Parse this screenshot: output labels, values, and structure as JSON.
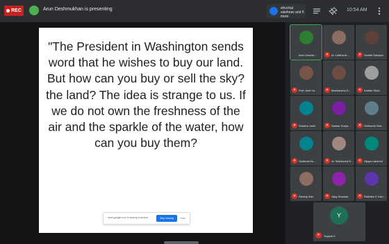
{
  "topbar": {
    "rec_label": "REC",
    "presenter_text": "Arun Deshmukhan is presenting",
    "badge_text": "shivchal vaishnav and 6 more",
    "clock": "10:54 AM",
    "icons": [
      "rec-dot-icon",
      "grid-view-icon",
      "pin-icon",
      "more-icon"
    ]
  },
  "slide": {
    "quote": "\"The President in Washington sends word that he wishes to buy our land. But how can you buy or sell the sky? the land? The idea is strange to us. If we do not own the freshness of the air and the sparkle of the water, how can you buy them?",
    "share_bar": {
      "message": "meet.google.com is sharing a window",
      "stop_label": "Stop sharing",
      "hide_label": "Hide"
    }
  },
  "participants": [
    {
      "name": "Arun Deshm…",
      "mic_muted": false,
      "face_color": "#2e7d32"
    },
    {
      "name": "Ar. Lalitha Ar…",
      "mic_muted": true,
      "face_color": "#8d6e63"
    },
    {
      "name": "Swathi Sanyam",
      "mic_muted": true,
      "face_color": "#5d4037"
    },
    {
      "name": "Prof. Amit Ya…",
      "mic_muted": true,
      "face_color": "#795548"
    },
    {
      "name": "Madhavsha S…",
      "mic_muted": true,
      "face_color": "#6d4c41"
    },
    {
      "name": "Kartikk Shah",
      "mic_muted": true,
      "face_color": "#9e9e9e"
    },
    {
      "name": "Shubha Joshi",
      "mic_muted": true,
      "face_color": "#00838f"
    },
    {
      "name": "Sankar Surya…",
      "mic_muted": true,
      "face_color": "#7b1fa2"
    },
    {
      "name": "Shrikanth Sha…",
      "mic_muted": true,
      "face_color": "#607d8b"
    },
    {
      "name": "Shalmali Ku…",
      "mic_muted": true,
      "face_color": "#00838f"
    },
    {
      "name": "Ar. Mahendra R…",
      "mic_muted": true,
      "face_color": "#a1887f"
    },
    {
      "name": "Vijaya Lakshmi",
      "mic_muted": true,
      "face_color": "#00897b"
    },
    {
      "name": "Raviraj Jain",
      "mic_muted": true,
      "face_color": "#8d6e63"
    },
    {
      "name": "Vijay Shankar",
      "mic_muted": true,
      "face_color": "#8e24aa"
    },
    {
      "name": "Radhika V. Kan…",
      "mic_muted": true,
      "face_color": "#5e35b1"
    }
  ],
  "self": {
    "initial": "Y",
    "name": "Yogesh K"
  }
}
